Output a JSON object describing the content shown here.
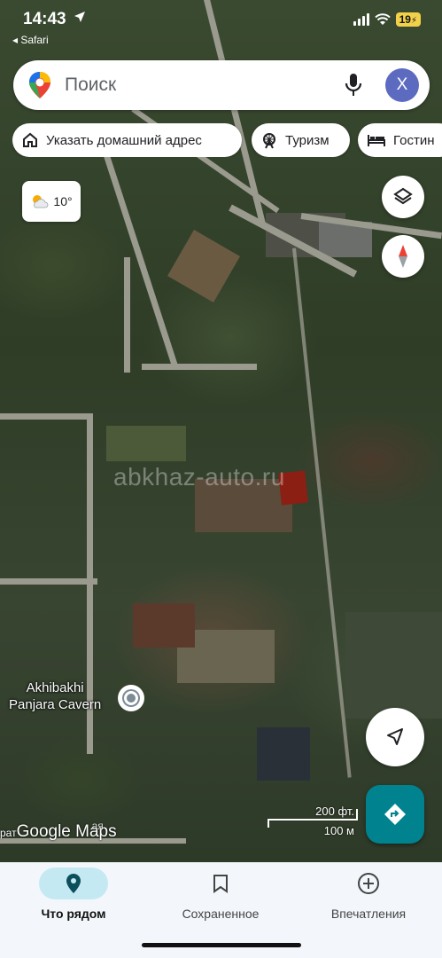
{
  "status_bar": {
    "time": "14:43",
    "back_app": "◂ Safari",
    "battery": "19"
  },
  "search": {
    "placeholder": "Поиск",
    "avatar_letter": "X"
  },
  "chips": [
    {
      "label": "Указать домашний адрес",
      "icon": "home-icon"
    },
    {
      "label": "Туризм",
      "icon": "ferris-wheel-icon"
    },
    {
      "label": "Гостин",
      "icon": "bed-icon"
    }
  ],
  "weather": {
    "temperature": "10°",
    "icon": "partly-cloudy-icon"
  },
  "map": {
    "watermark": "abkhaz-auto.ru",
    "place_name_line1": "Akhibakhi",
    "place_name_line2": "Panjara Cavern",
    "google_logo": "Google Maps",
    "logo_prefix": "рат",
    "logo_suffix": "ая",
    "scale_imperial": "200 фт.",
    "scale_metric": "100 м"
  },
  "bottom_nav": {
    "items": [
      {
        "label": "Что рядом",
        "icon": "location-pin-icon",
        "active": true
      },
      {
        "label": "Сохраненное",
        "icon": "bookmark-icon",
        "active": false
      },
      {
        "label": "Впечатления",
        "icon": "add-circle-icon",
        "active": false
      }
    ]
  },
  "colors": {
    "accent": "#00838f",
    "active_pill": "#c5e9f2",
    "avatar": "#5c6bc0"
  }
}
